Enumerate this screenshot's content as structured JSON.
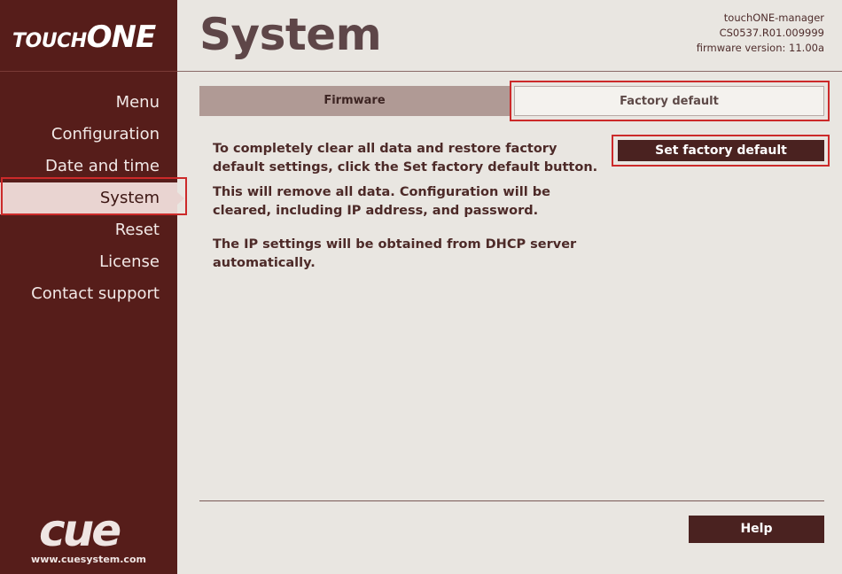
{
  "brand": {
    "logo_touch": "TOUCH",
    "logo_one": "ONE",
    "cue_logo": "cue",
    "website": "www.cuesystem.com"
  },
  "header": {
    "title": "System",
    "device_name": "touchONE-manager",
    "serial": "CS0537.R01.009999",
    "firmware": "firmware version: 11.00a"
  },
  "sidebar": {
    "items": [
      {
        "label": "Menu"
      },
      {
        "label": "Configuration"
      },
      {
        "label": "Date and time"
      },
      {
        "label": "System",
        "active": true
      },
      {
        "label": "Reset"
      },
      {
        "label": "License"
      },
      {
        "label": "Contact support"
      }
    ]
  },
  "tabs": [
    {
      "label": "Firmware"
    },
    {
      "label": "Factory default",
      "active": true
    }
  ],
  "content": {
    "para1": "To completely clear all data and restore factory default settings, click the Set factory default button.",
    "para2": "This will remove all data. Configuration will be cleared, including IP address, and password.",
    "para3": "The IP settings will be obtained from DHCP server automatically.",
    "action_button": "Set factory default"
  },
  "footer": {
    "help_label": "Help"
  },
  "colors": {
    "sidebar": "#561d1a",
    "accent_dark": "#4a2220",
    "highlight": "#cc2a2a"
  }
}
